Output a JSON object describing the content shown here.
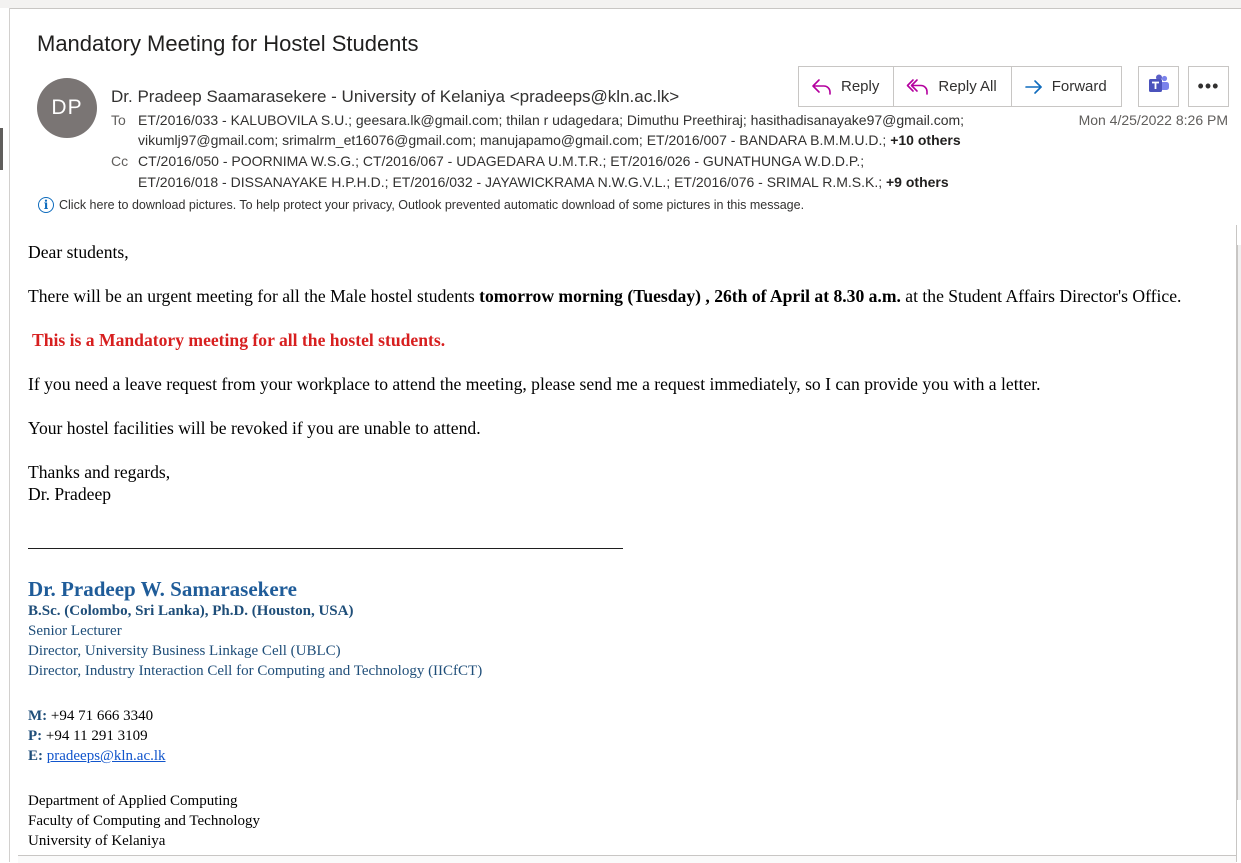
{
  "email": {
    "subject": "Mandatory Meeting for Hostel Students",
    "avatar_initials": "DP",
    "sender": "Dr. Pradeep Saamarasekere - University of Kelaniya <pradeeps@kln.ac.lk>",
    "to_label": "To",
    "to_line1": "ET/2016/033 - KALUBOVILA S.U.; geesara.lk@gmail.com; thilan r udagedara; Dimuthu Preethiraj; hasithadisanayake97@gmail.com;",
    "to_line2": "vikumlj97@gmail.com; srimalrm_et16076@gmail.com; manujapamo@gmail.com; ET/2016/007 - BANDARA B.M.M.U.D.; ",
    "to_others": "+10 others",
    "cc_label": "Cc",
    "cc_line1": "CT/2016/050 - POORNIMA W.S.G.; CT/2016/067 - UDAGEDARA U.M.T.R.; ET/2016/026 - GUNATHUNGA W.D.D.P.;",
    "cc_line2": "ET/2016/018 - DISSANAYAKE H.P.H.D.; ET/2016/032 - JAYAWICKRAMA N.W.G.V.L.; ET/2016/076 - SRIMAL R.M.S.K.; ",
    "cc_others": "+9 others",
    "date": "Mon 4/25/2022 8:26 PM",
    "info_bar": "Click here to download pictures. To help protect your privacy, Outlook prevented automatic download of some pictures in this message."
  },
  "actions": {
    "reply": "Reply",
    "reply_all": "Reply All",
    "forward": "Forward",
    "more": "•••"
  },
  "body": {
    "greeting": "Dear students,",
    "p1_start": "There will be an urgent meeting for all the Male hostel students ",
    "p1_bold": "tomorrow morning (Tuesday) , 26th of April at 8.30 a.m.",
    "p1_end": " at the Student Affairs Director's Office.",
    "mandatory": "This is a Mandatory meeting for all the hostel students.",
    "p2": "If you need a leave request from your workplace to attend the meeting, please send me a request immediately, so I can provide you with a letter.",
    "p3": "Your hostel facilities will be revoked if you are unable to attend.",
    "closing1": "Thanks and regards,",
    "closing2": "Dr. Pradeep"
  },
  "signature": {
    "name": "Dr. Pradeep W. Samarasekere",
    "degrees": "B.Sc. (Colombo, Sri Lanka), Ph.D. (Houston, USA)",
    "title1": "Senior Lecturer",
    "title2": "Director, University Business Linkage Cell (UBLC)",
    "title3": "Director, Industry Interaction Cell for Computing and Technology (IICfCT)",
    "m_label": "M:",
    "mobile": " +94 71 666 3340",
    "p_label": "P:",
    "phone": " +94 11 291 3109",
    "e_label": "E:",
    "email": "pradeeps@kln.ac.lk",
    "dept1": "Department of Applied Computing",
    "dept2": "Faculty of Computing and Technology",
    "dept3": "University of Kelaniya"
  },
  "colors": {
    "accent": "#0f6cbd",
    "mandatory_red": "#d71f1f",
    "signature_blue": "#1f4e79",
    "reply_icon": "#b4009e",
    "teams_purple": "#5b5fc7"
  }
}
